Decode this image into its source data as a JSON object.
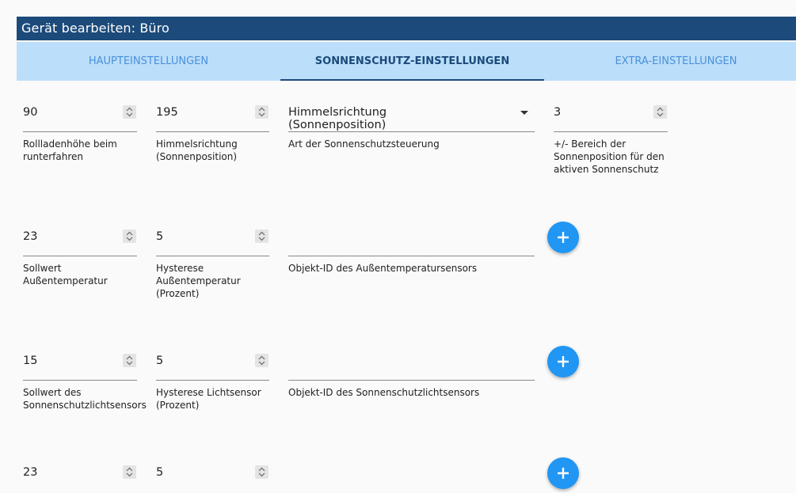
{
  "window": {
    "title": "Gerät bearbeiten: Büro"
  },
  "tabs": [
    {
      "label": "HAUPTEINSTELLUNGEN"
    },
    {
      "label": "SONNENSCHUTZ-EINSTELLUNGEN",
      "active": true
    },
    {
      "label": "EXTRA-EINSTELLUNGEN"
    }
  ],
  "rows": [
    {
      "f1": {
        "value": "90",
        "label": "Rollladenhöhe beim runterfahren"
      },
      "f2": {
        "value": "195",
        "label": "Himmelsrichtung (Sonnenposition)"
      },
      "f3": {
        "value": "Himmelsrichtung (Sonnenposition)",
        "label": "Art der Sonnenschutzsteuerung"
      },
      "f4": {
        "value": "3",
        "label": "+/- Bereich der Sonnenposition für den aktiven Sonnenschutz"
      }
    },
    {
      "f1": {
        "value": "23",
        "label": "Sollwert Außentemperatur"
      },
      "f2": {
        "value": "5",
        "label": "Hysterese Außentemperatur (Prozent)"
      },
      "f3": {
        "value": "",
        "label": "Objekt-ID des Außentemperatursensors"
      }
    },
    {
      "f1": {
        "value": "15",
        "label": "Sollwert des Sonnenschutzlichtsensors"
      },
      "f2": {
        "value": "5",
        "label": "Hysterese Lichtsensor (Prozent)"
      },
      "f3": {
        "value": "",
        "label": "Objekt-ID des Sonnenschutzlichtsensors"
      }
    },
    {
      "f1": {
        "value": "23",
        "label": ""
      },
      "f2": {
        "value": "5",
        "label": ""
      },
      "f3": {
        "value": "",
        "label": ""
      }
    }
  ],
  "colors": {
    "header": "#1c4a7a",
    "tabbar": "#bbdefb",
    "accent": "#2196f3"
  },
  "icons": {
    "add": "plus-icon",
    "spinner": "spinner-arrows-icon",
    "dropdown": "dropdown-arrow-icon"
  }
}
